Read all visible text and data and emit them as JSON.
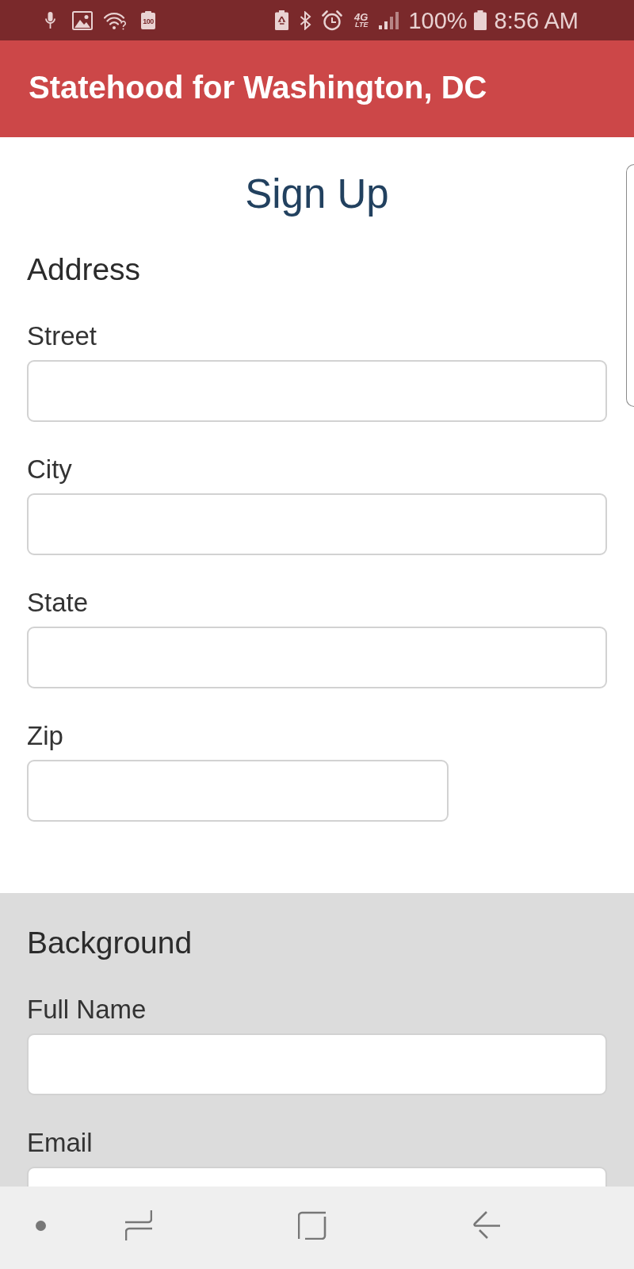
{
  "status_bar": {
    "battery_badge": "100",
    "network": {
      "generation": "4G",
      "technology": "LTE"
    },
    "battery_percent": "100%",
    "time": "8:56 AM"
  },
  "app_bar": {
    "title": "Statehood for Washington, DC"
  },
  "page_title": "Sign Up",
  "sections": [
    {
      "heading": "Address",
      "kind": "plain",
      "fields": [
        {
          "label": "Street",
          "kind": "wide"
        },
        {
          "label": "City",
          "kind": "wide"
        },
        {
          "label": "State",
          "kind": "wide"
        },
        {
          "label": "Zip",
          "kind": "narrow"
        }
      ]
    },
    {
      "heading": "Background",
      "kind": "shaded",
      "fields": [
        {
          "label": "Full Name",
          "kind": "wide"
        },
        {
          "label": "Email",
          "kind": "wide"
        }
      ]
    }
  ]
}
